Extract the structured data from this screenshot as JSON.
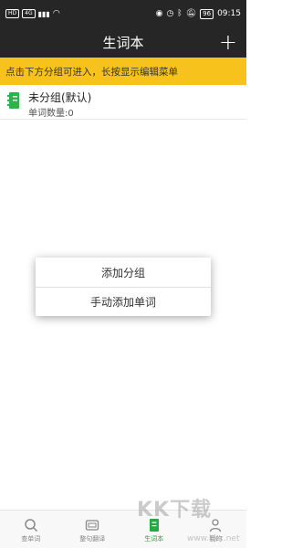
{
  "status_bar": {
    "chips": [
      "HD",
      "4G"
    ],
    "battery": "96",
    "time": "09:15"
  },
  "header": {
    "title": "生词本",
    "add_label": "+"
  },
  "hint": "点击下方分组可进入，长按显示编辑菜单",
  "groups": [
    {
      "name": "未分组(默认)",
      "count_text": "单词数量:0"
    }
  ],
  "context_menu": {
    "items": [
      "添加分组",
      "手动添加单词"
    ]
  },
  "bottom_nav": {
    "items": [
      {
        "label": "查单词",
        "icon": "search-icon",
        "active": false
      },
      {
        "label": "整句翻译",
        "icon": "translate-icon",
        "active": false
      },
      {
        "label": "生词本",
        "icon": "notebook-icon",
        "active": true
      },
      {
        "label": "我的",
        "icon": "user-icon",
        "active": false
      }
    ],
    "active_color": "#27a845"
  },
  "watermark": {
    "text": "KK下载",
    "sub": "www.kkx.net"
  }
}
